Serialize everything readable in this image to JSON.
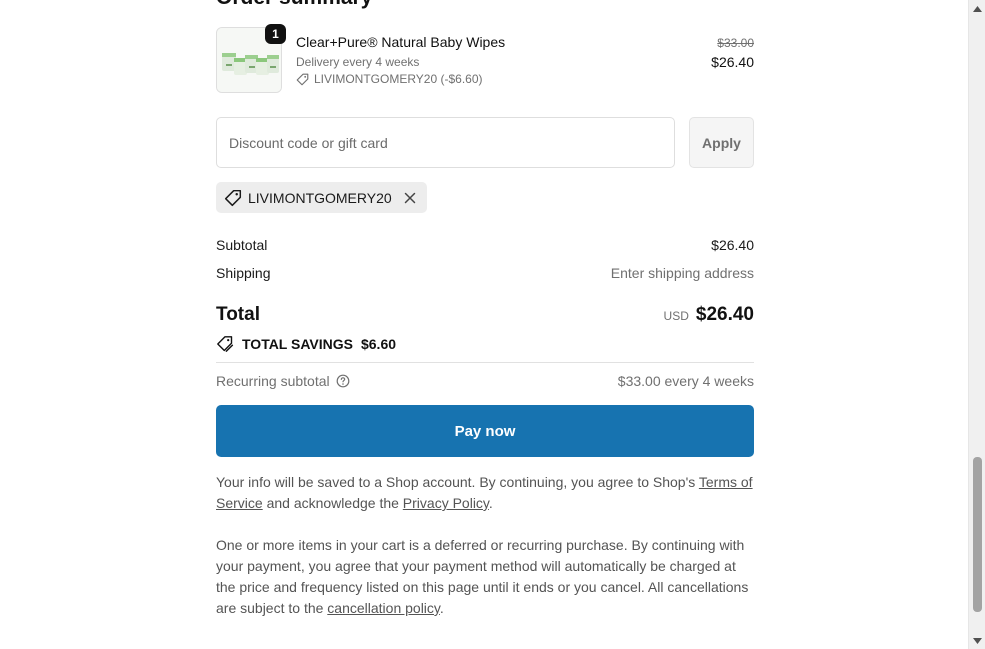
{
  "summary": {
    "title": "Order summary"
  },
  "product": {
    "quantity": "1",
    "name": "Clear+Pure® Natural Baby Wipes",
    "delivery": "Delivery every 4 weeks",
    "discount_line": "LIVIMONTGOMERY20 (-$6.60)",
    "price_original": "$33.00",
    "price_current": "$26.40",
    "thumbnail_icon": "product-image"
  },
  "discount": {
    "placeholder": "Discount code or gift card",
    "value": "",
    "apply_label": "Apply",
    "applied_code": "LIVIMONTGOMERY20"
  },
  "totals": {
    "subtotal_label": "Subtotal",
    "subtotal_value": "$26.40",
    "shipping_label": "Shipping",
    "shipping_value": "Enter shipping address",
    "total_label": "Total",
    "currency": "USD",
    "total_value": "$26.40",
    "savings_label": "TOTAL SAVINGS",
    "savings_value": "$6.60",
    "recurring_label": "Recurring subtotal",
    "recurring_value": "$33.00 every 4 weeks"
  },
  "pay_button": {
    "label": "Pay now",
    "color": "#1773b0"
  },
  "legal": {
    "shop_text_1": "Your info will be saved to a Shop account. By continuing, you agree to Shop's",
    "terms_link": "Terms of Service",
    "shop_text_2": "and acknowledge the",
    "privacy_link": "Privacy Policy",
    "shop_text_3": ".",
    "recurring_text_1": "One or more items in your cart is a deferred or recurring purchase. By continuing with your payment, you agree that your payment method will automatically be charged at the price and frequency listed on this page until it ends or you cancel. All cancellations are subject to the",
    "cancellation_link": "cancellation policy",
    "recurring_text_2": "."
  }
}
